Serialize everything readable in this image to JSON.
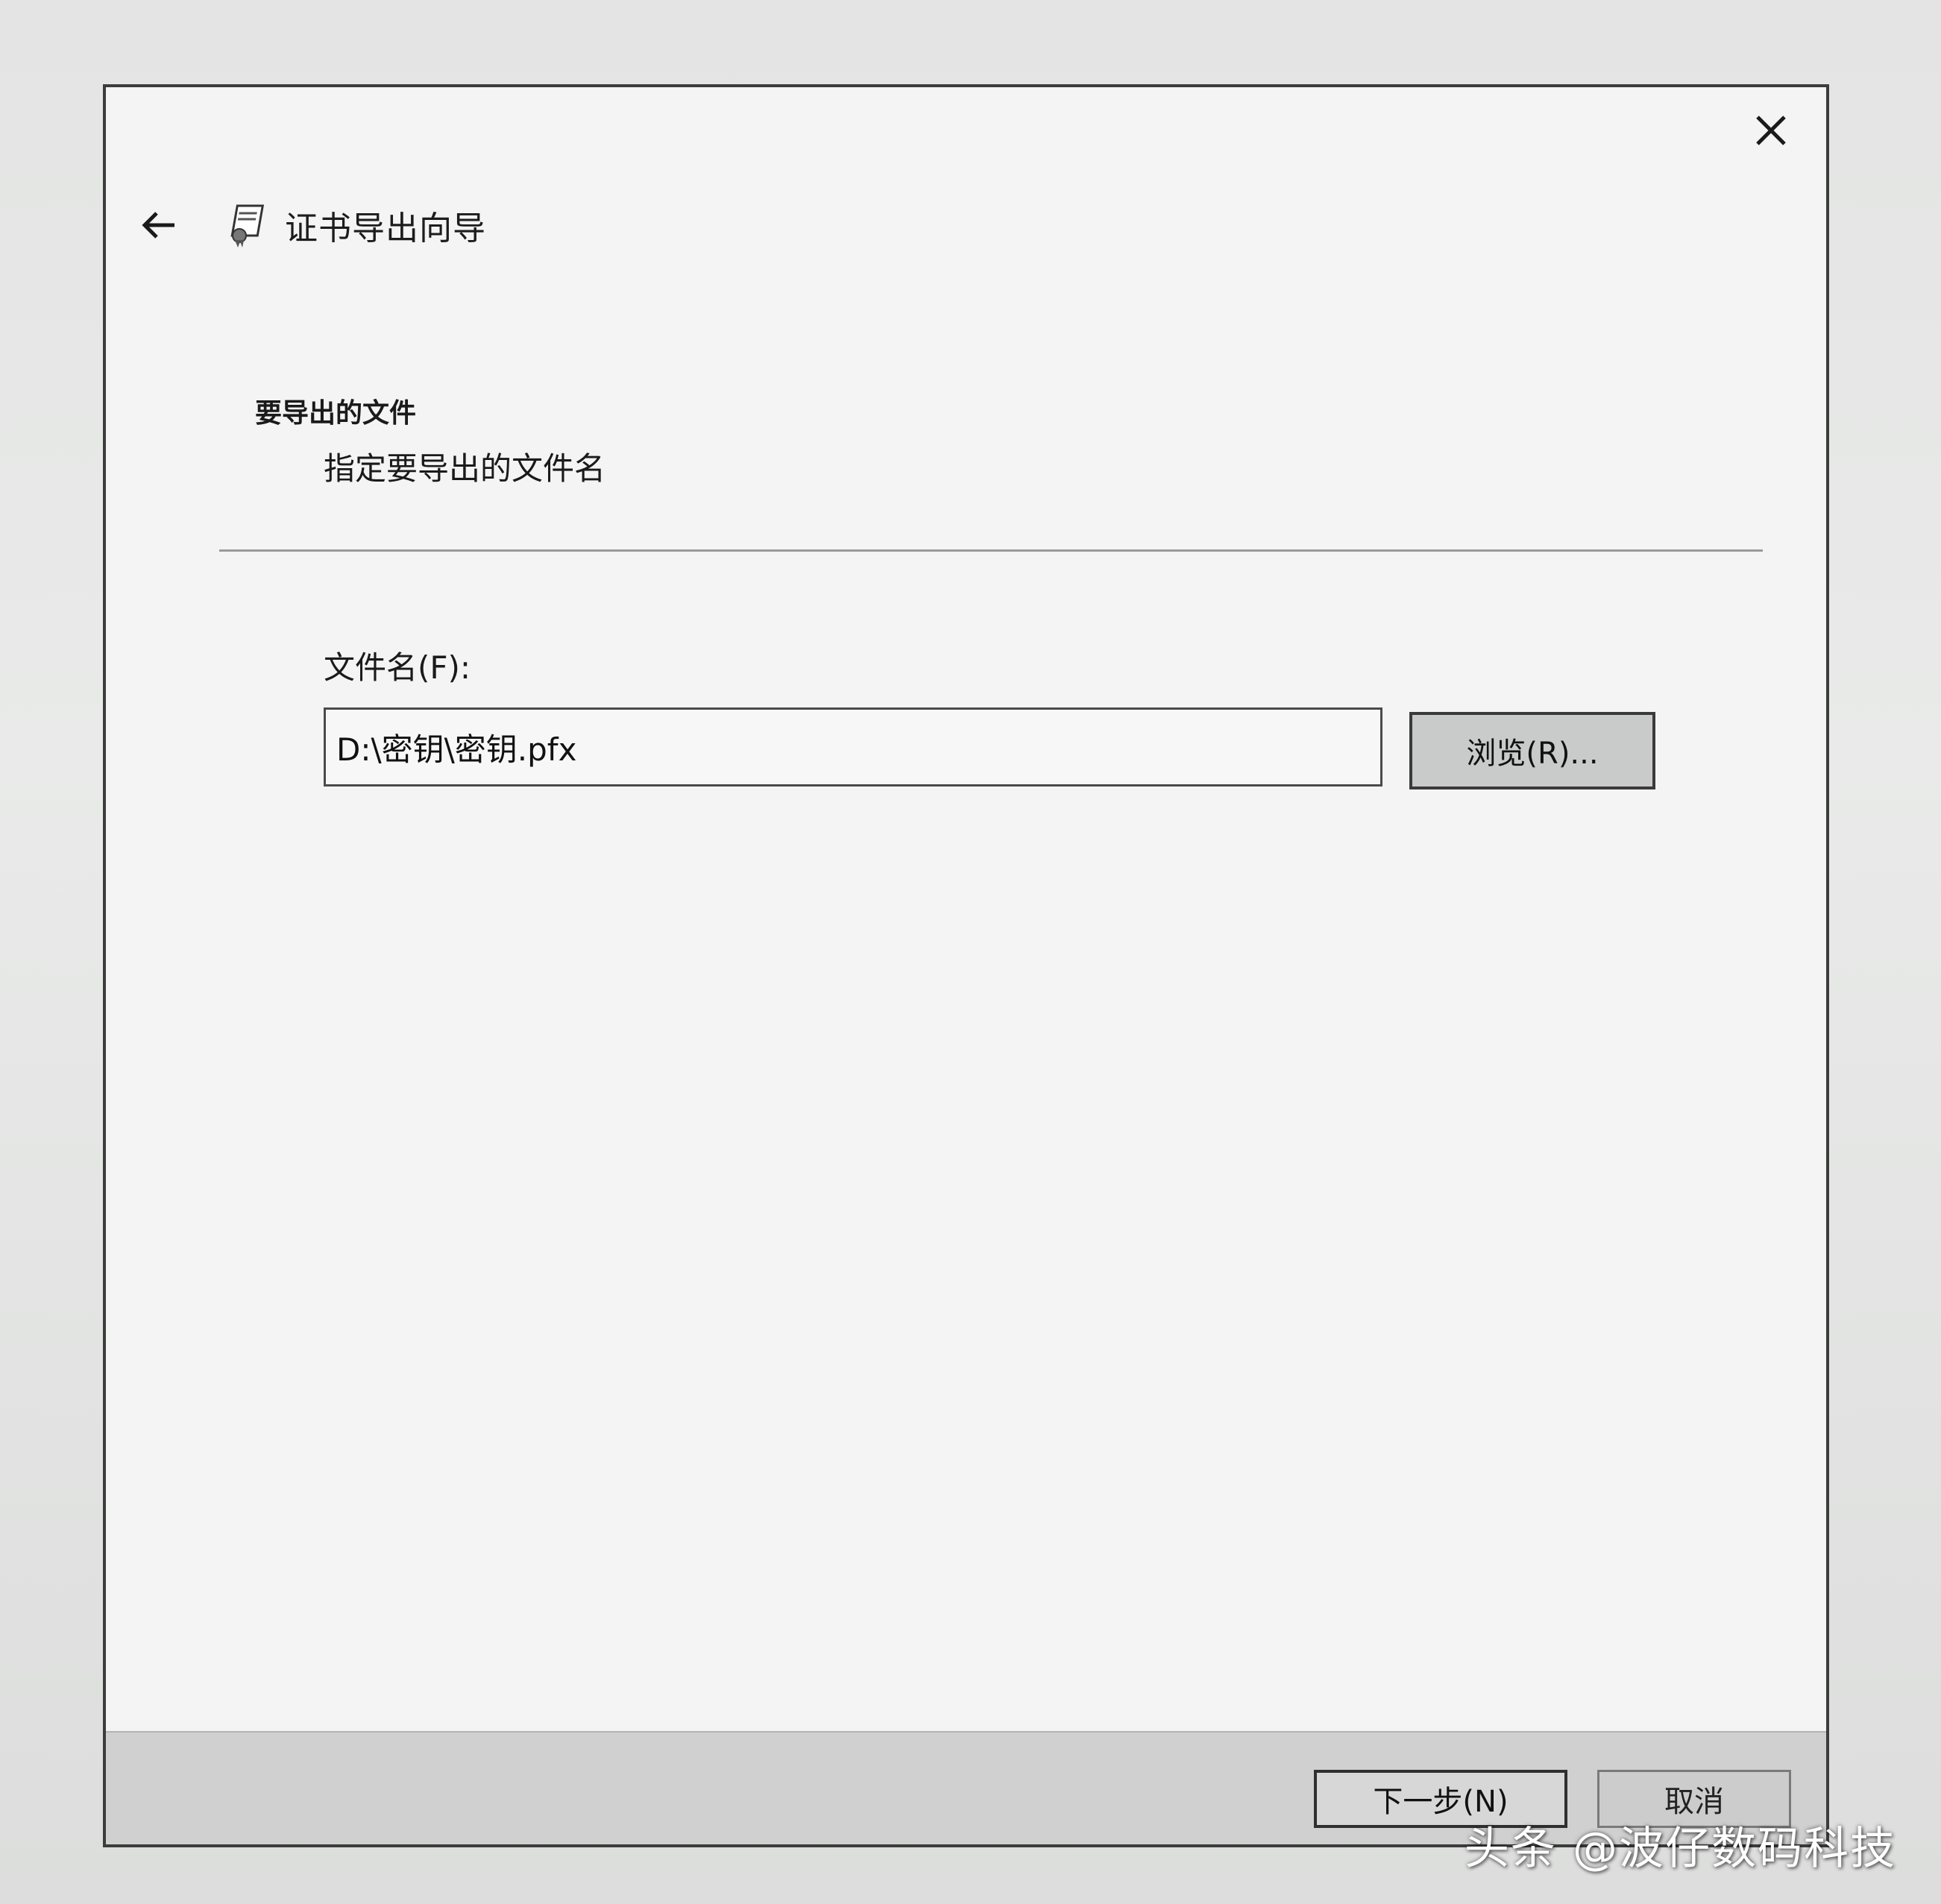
{
  "window": {
    "title": "证书导出向导"
  },
  "section": {
    "title": "要导出的文件",
    "subtitle": "指定要导出的文件名"
  },
  "form": {
    "file_label": "文件名(F):",
    "file_value": "D:\\密钥\\密钥.pfx",
    "browse_label": "浏览(R)..."
  },
  "footer": {
    "next_label": "下一步(N)",
    "cancel_label": "取消"
  },
  "watermark": {
    "text": "头条 @波仔数码科技"
  },
  "icons": {
    "close": "close-icon",
    "back": "back-arrow-icon",
    "certificate": "certificate-icon"
  }
}
